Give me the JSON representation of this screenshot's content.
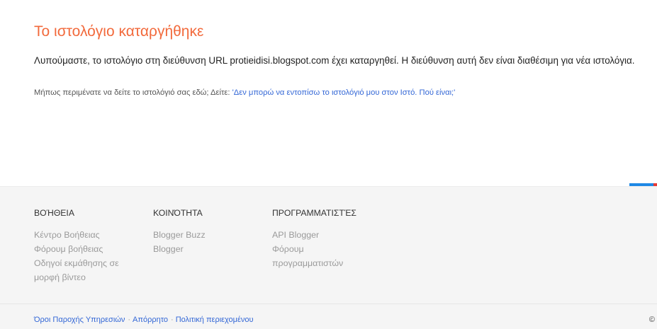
{
  "main": {
    "title": "Το ιστολόγιο καταργήθηκε",
    "message": "Λυπούμαστε, το ιστολόγιο στη διεύθυνση URL protieidisi.blogspot.com έχει καταργηθεί. Η διεύθυνση αυτή δεν είναι διαθέσιμη για νέα ιστολόγια.",
    "hint_prefix": "Μήπως περιμένατε να δείτε το ιστολόγιό σας εδώ; Δείτε: ",
    "hint_link": "'Δεν μπορώ να εντοπίσω το ιστολόγιό μου στον Ιστό. Πού είναι;'"
  },
  "colors": {
    "title": "#f26a3c",
    "link": "#3367d6",
    "footer_bg": "#f5f5f5",
    "accent_blue": "#1e88e5",
    "accent_red": "#e53935"
  },
  "footer": {
    "help": {
      "heading": "ΒΟΉΘΕΙΑ",
      "links": [
        "Κέντρο Βοήθειας",
        "Φόρουμ βοήθειας",
        "Οδηγοί εκμάθησης σε μορφή βίντεο"
      ]
    },
    "community": {
      "heading": "ΚΟΙΝΌΤΗΤΑ",
      "links": [
        "Blogger Buzz",
        "Blogger"
      ]
    },
    "developers": {
      "heading": "ΠΡΟΓΡΑΜΜΑΤΙΣΤΈΣ",
      "links": [
        "API Blogger",
        "Φόρουμ προγραμματιστών"
      ]
    }
  },
  "bottom": {
    "links": [
      "Όροι Παροχής Υπηρεσιών",
      "Απόρρητο",
      "Πολιτική περιεχομένου"
    ],
    "separator": "·",
    "copyright": "©"
  }
}
